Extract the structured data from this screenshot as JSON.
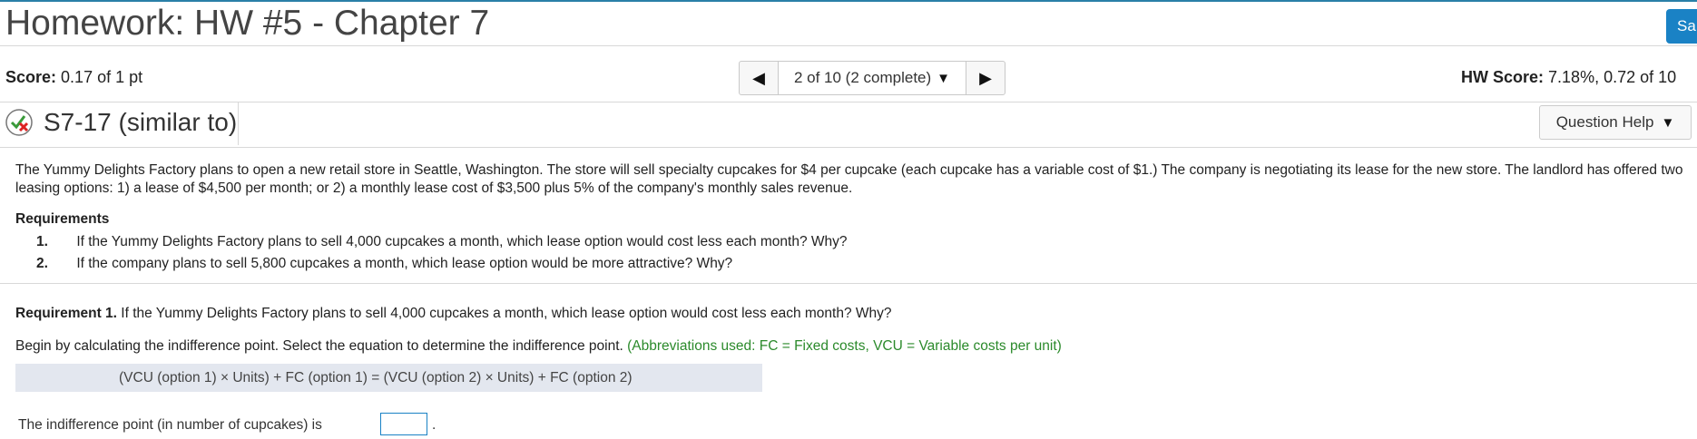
{
  "header": {
    "title": "Homework: HW #5 - Chapter 7",
    "save_label": "Sa"
  },
  "score_bar": {
    "score_label": "Score:",
    "score_value": "0.17 of 1 pt",
    "nav_position": "2 of 10 (2 complete)",
    "hw_score_label": "HW Score:",
    "hw_score_value": "7.18%, 0.72 of 10"
  },
  "question": {
    "id": "S7-17 (similar to)",
    "help_label": "Question Help",
    "status_icon": "partial-credit-icon",
    "intro": "The Yummy Delights Factory plans to open a new retail store in Seattle, Washington. The store will sell specialty cupcakes for $4 per cupcake (each cupcake has a variable cost of $1.) The company is negotiating its lease for the new store. The landlord has offered two leasing options: 1) a lease of $4,500 per month; or 2) a monthly lease cost of $3,500 plus 5% of the company's monthly sales revenue.",
    "requirements_heading": "Requirements",
    "requirements": [
      {
        "num": "1.",
        "text": "If the Yummy Delights Factory plans to sell 4,000 cupcakes a month, which lease option would cost less each month? Why?"
      },
      {
        "num": "2.",
        "text": "If the company plans to sell 5,800 cupcakes a month, which lease option would be more attractive? Why?"
      }
    ],
    "req1_label": "Requirement 1.",
    "req1_text": " If the Yummy Delights Factory plans to sell 4,000 cupcakes a month, which lease option would cost less each month? Why?",
    "begin_text": "Begin by calculating the indifference point. Select the equation to determine the indifference point. ",
    "abbreviations": "(Abbreviations used: FC = Fixed costs, VCU = Variable costs per unit)",
    "equation": "(VCU (option 1) × Units) + FC (option 1) = (VCU (option 2) × Units) + FC (option 2)",
    "indifference_label": "The indifference point (in number of cupcakes) is",
    "indifference_value": "",
    "period": "."
  },
  "colors": {
    "accent": "#1a82c5",
    "abbreviation_text": "#2b8a2b",
    "equation_bg": "#e3e7ef"
  }
}
